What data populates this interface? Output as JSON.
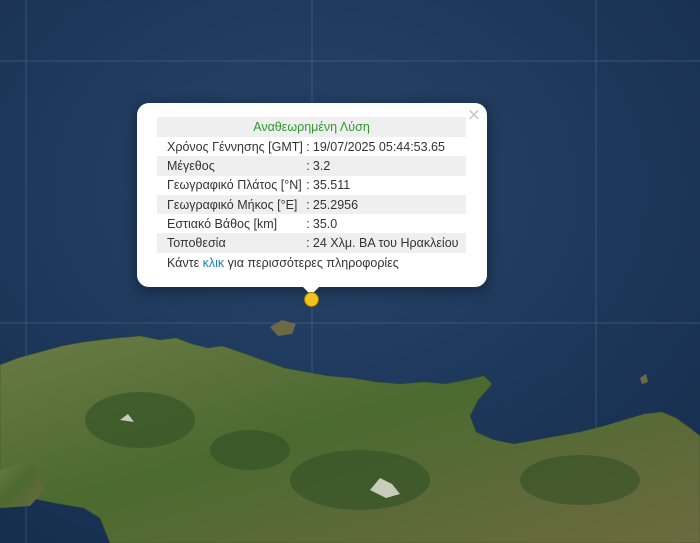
{
  "popup": {
    "title": "Αναθεωρημένη Λύση",
    "close_symbol": "×",
    "rows": [
      {
        "label": "Χρόνος Γέννησης [GMT]",
        "value": "19/07/2025 05:44:53.65"
      },
      {
        "label": "Μέγεθος",
        "value": "3.2"
      },
      {
        "label": "Γεωγραφικό Πλάτος [°N]",
        "value": "35.511"
      },
      {
        "label": "Γεωγραφικό Μήκος [°E]",
        "value": "25.2956"
      },
      {
        "label": "Εστιακό Βάθος [km]",
        "value": "35.0"
      },
      {
        "label": "Τοποθεσία",
        "value": "24 Χλμ. ΒΑ του Ηρακλείου"
      }
    ],
    "more_prefix": "Κάντε",
    "more_link": "κλικ",
    "more_suffix": "για περισσότερες πληροφορίες"
  },
  "map": {
    "sea_color": "#1f3b5e",
    "land_color": "#4d6a33",
    "marker_color": "#f0c419"
  }
}
